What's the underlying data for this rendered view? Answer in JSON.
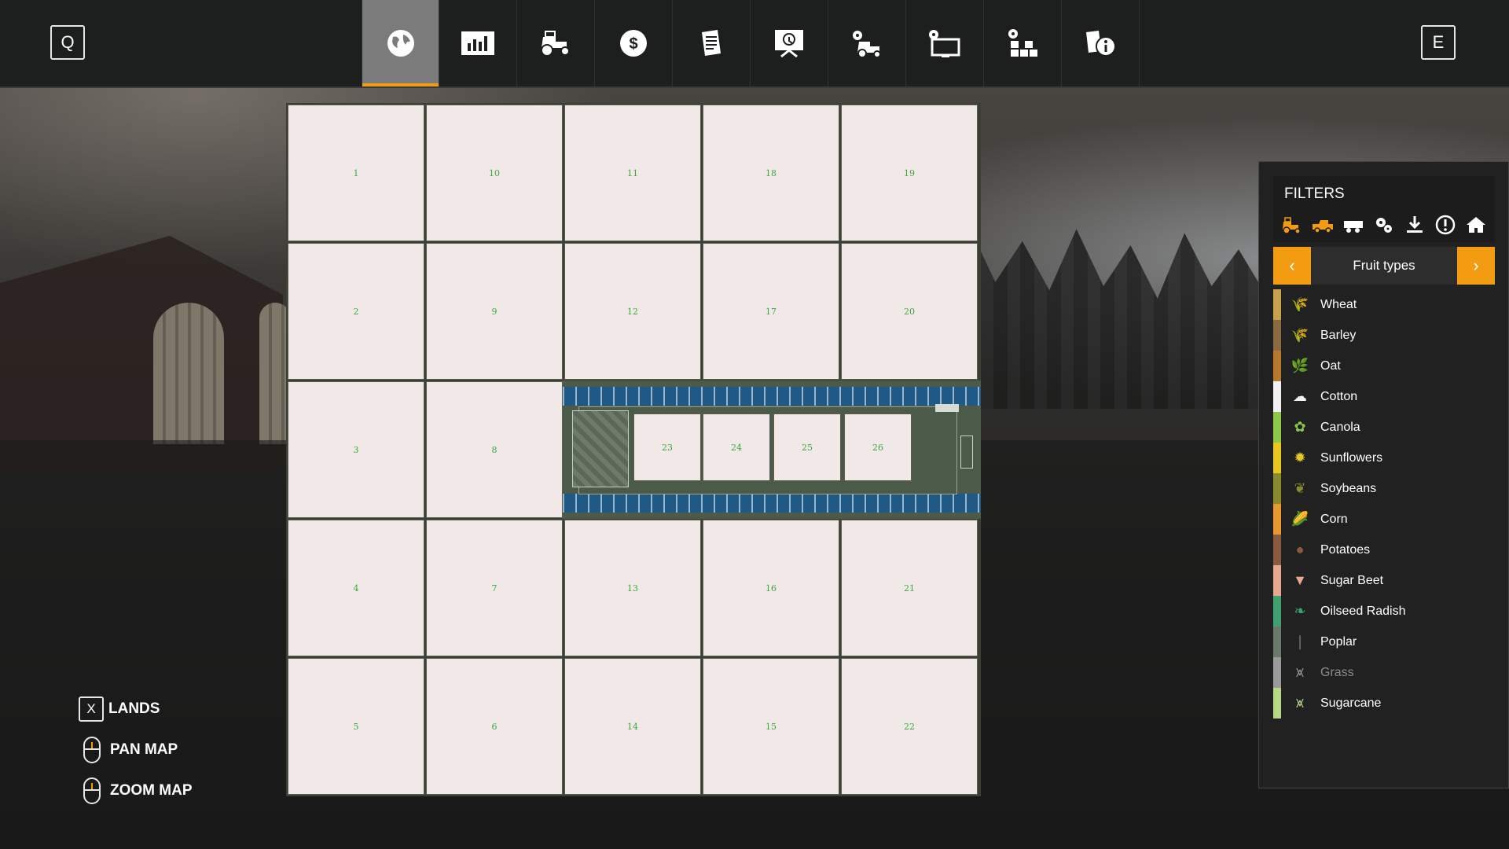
{
  "header": {
    "left_key": "Q",
    "right_key": "E",
    "tabs": [
      {
        "icon": "globe-map-icon",
        "active": true
      },
      {
        "icon": "statistics-chart-icon",
        "active": false
      },
      {
        "icon": "tractor-icon",
        "active": false
      },
      {
        "icon": "finances-dollar-icon",
        "active": false
      },
      {
        "icon": "contracts-papers-icon",
        "active": false
      },
      {
        "icon": "tour-presentation-icon",
        "active": false
      },
      {
        "icon": "vehicle-settings-icon",
        "active": false
      },
      {
        "icon": "display-settings-icon",
        "active": false
      },
      {
        "icon": "production-chains-icon",
        "active": false
      },
      {
        "icon": "help-info-icon",
        "active": false
      }
    ]
  },
  "map": {
    "fields": [
      "1",
      "10",
      "11",
      "18",
      "19",
      "2",
      "9",
      "12",
      "17",
      "20",
      "3",
      "8",
      "4",
      "7",
      "13",
      "16",
      "21",
      "5",
      "6",
      "14",
      "15",
      "22"
    ],
    "farm_fields": [
      "23",
      "24",
      "25",
      "26"
    ]
  },
  "controls": {
    "lands_key": "X",
    "lands_label": "LANDS",
    "pan_label": "PAN MAP",
    "zoom_label": "ZOOM MAP"
  },
  "filters": {
    "title": "FILTERS",
    "filter_icons": [
      "tractor-filter-icon",
      "combine-filter-icon",
      "trailer-filter-icon",
      "tools-filter-icon",
      "selling-point-icon",
      "warning-icon",
      "farm-house-icon"
    ],
    "selector_label": "Fruit types",
    "items": [
      {
        "label": "Wheat",
        "color": "#c8a050",
        "glyph": "🌾",
        "dim": false
      },
      {
        "label": "Barley",
        "color": "#8a6a40",
        "glyph": "🌾",
        "dim": false
      },
      {
        "label": "Oat",
        "color": "#b87830",
        "glyph": "🌿",
        "dim": false
      },
      {
        "label": "Cotton",
        "color": "#f2f2f2",
        "glyph": "☁",
        "dim": false
      },
      {
        "label": "Canola",
        "color": "#8cc84a",
        "glyph": "✿",
        "dim": false
      },
      {
        "label": "Sunflowers",
        "color": "#e8c820",
        "glyph": "✹",
        "dim": false
      },
      {
        "label": "Soybeans",
        "color": "#8a8a30",
        "glyph": "❦",
        "dim": false
      },
      {
        "label": "Corn",
        "color": "#e89830",
        "glyph": "🌽",
        "dim": false
      },
      {
        "label": "Potatoes",
        "color": "#8a5a40",
        "glyph": "●",
        "dim": false
      },
      {
        "label": "Sugar Beet",
        "color": "#e8a890",
        "glyph": "▼",
        "dim": false
      },
      {
        "label": "Oilseed Radish",
        "color": "#40a070",
        "glyph": "❧",
        "dim": false
      },
      {
        "label": "Poplar",
        "color": "#6a7a6a",
        "glyph": "❘",
        "dim": false
      },
      {
        "label": "Grass",
        "color": "#9a9a9a",
        "glyph": "⩙",
        "dim": true
      },
      {
        "label": "Sugarcane",
        "color": "#b8d888",
        "glyph": "⩙",
        "dim": false
      }
    ]
  }
}
